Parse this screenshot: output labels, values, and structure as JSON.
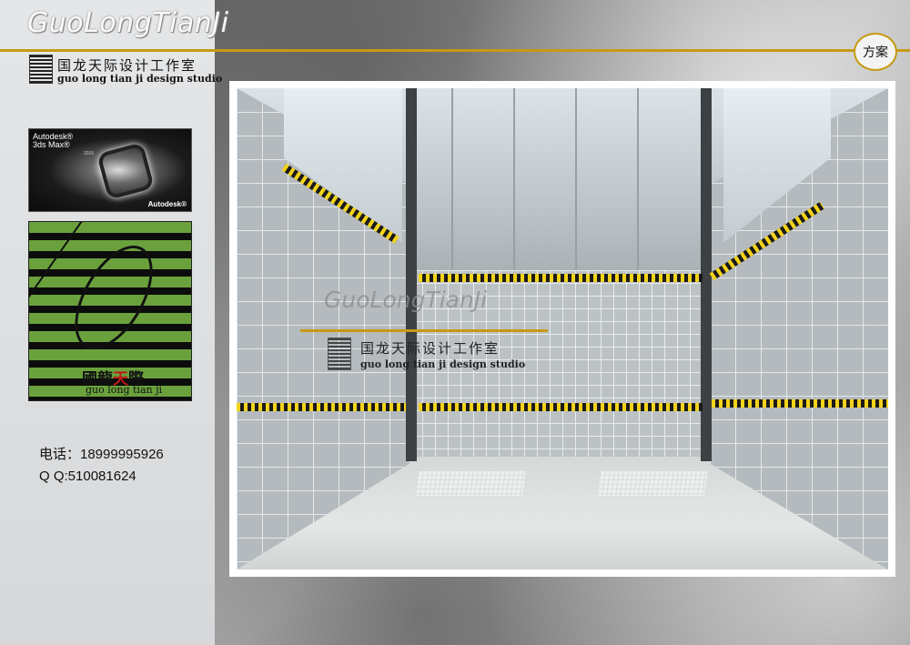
{
  "brand": {
    "title": "GuoLongTianJi",
    "cn_name": "国龙天际设计工作室",
    "en_name": "guo long tian ji design studio"
  },
  "software_badge": {
    "line1": "Autodesk®",
    "line2": "3ds Max®",
    "line3": "2015",
    "corp": "Autodesk®"
  },
  "logo_card": {
    "cn_part1": "國龍",
    "cn_part2": "天",
    "cn_part3": "際",
    "en": "guo long tian ji"
  },
  "contact": {
    "phone": "电话：18999995926",
    "qq": "Q  Q:510081624"
  },
  "section_badge": "方案",
  "watermark": {
    "title": "GuoLongTianJi",
    "cn_name": "国龙天际设计工作室",
    "en_name": "guo long tian ji design studio"
  },
  "colors": {
    "accent_gold": "#c79a13",
    "logo_green": "#6aa13d",
    "stripe_yellow": "#f3d319"
  }
}
